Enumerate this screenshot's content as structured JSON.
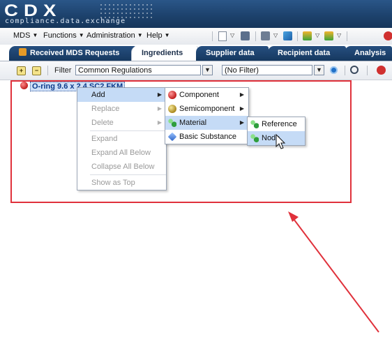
{
  "header": {
    "logo_text": "CDX",
    "logo_subtitle": "compliance.data.exchange"
  },
  "menubar": {
    "items": [
      {
        "label": "MDS"
      },
      {
        "label": "Functions"
      },
      {
        "label": "Administration"
      },
      {
        "label": "Help"
      }
    ]
  },
  "tabs": [
    {
      "label": "Received MDS Requests",
      "active": false
    },
    {
      "label": "Ingredients",
      "active": true
    },
    {
      "label": "Supplier data",
      "active": false
    },
    {
      "label": "Recipient data",
      "active": false
    },
    {
      "label": "Analysis",
      "active": false
    }
  ],
  "filterbar": {
    "filter_label": "Filter",
    "filter_value": "Common Regulations",
    "second_filter_value": "(No Filter)"
  },
  "tree": {
    "root_node_label": "O-ring 9.6 x 2.4 SC2 FKM"
  },
  "context_menu": {
    "items": [
      {
        "label": "Add",
        "enabled": true,
        "has_submenu": true,
        "hover": true
      },
      {
        "label": "Replace",
        "enabled": false,
        "has_submenu": true
      },
      {
        "label": "Delete",
        "enabled": false,
        "has_submenu": true
      },
      {
        "label": "Expand",
        "enabled": false
      },
      {
        "label": "Expand All Below",
        "enabled": false
      },
      {
        "label": "Collapse All Below",
        "enabled": false
      },
      {
        "label": "Show as Top",
        "enabled": false
      }
    ]
  },
  "add_submenu": {
    "items": [
      {
        "label": "Component",
        "icon": "component-icon",
        "has_submenu": true
      },
      {
        "label": "Semicomponent",
        "icon": "semicomponent-icon",
        "has_submenu": true
      },
      {
        "label": "Material",
        "icon": "material-icon",
        "has_submenu": true,
        "hover": true
      },
      {
        "label": "Basic Substance",
        "icon": "basic-substance-icon",
        "has_submenu": false
      }
    ]
  },
  "material_submenu": {
    "items": [
      {
        "label": "Reference",
        "icon": "material-icon"
      },
      {
        "label": "Node",
        "icon": "material-icon",
        "hover": true
      }
    ]
  },
  "colors": {
    "header_blue": "#1d426d",
    "highlight_red": "#e0313b",
    "menu_hover": "#c5dbf6"
  }
}
